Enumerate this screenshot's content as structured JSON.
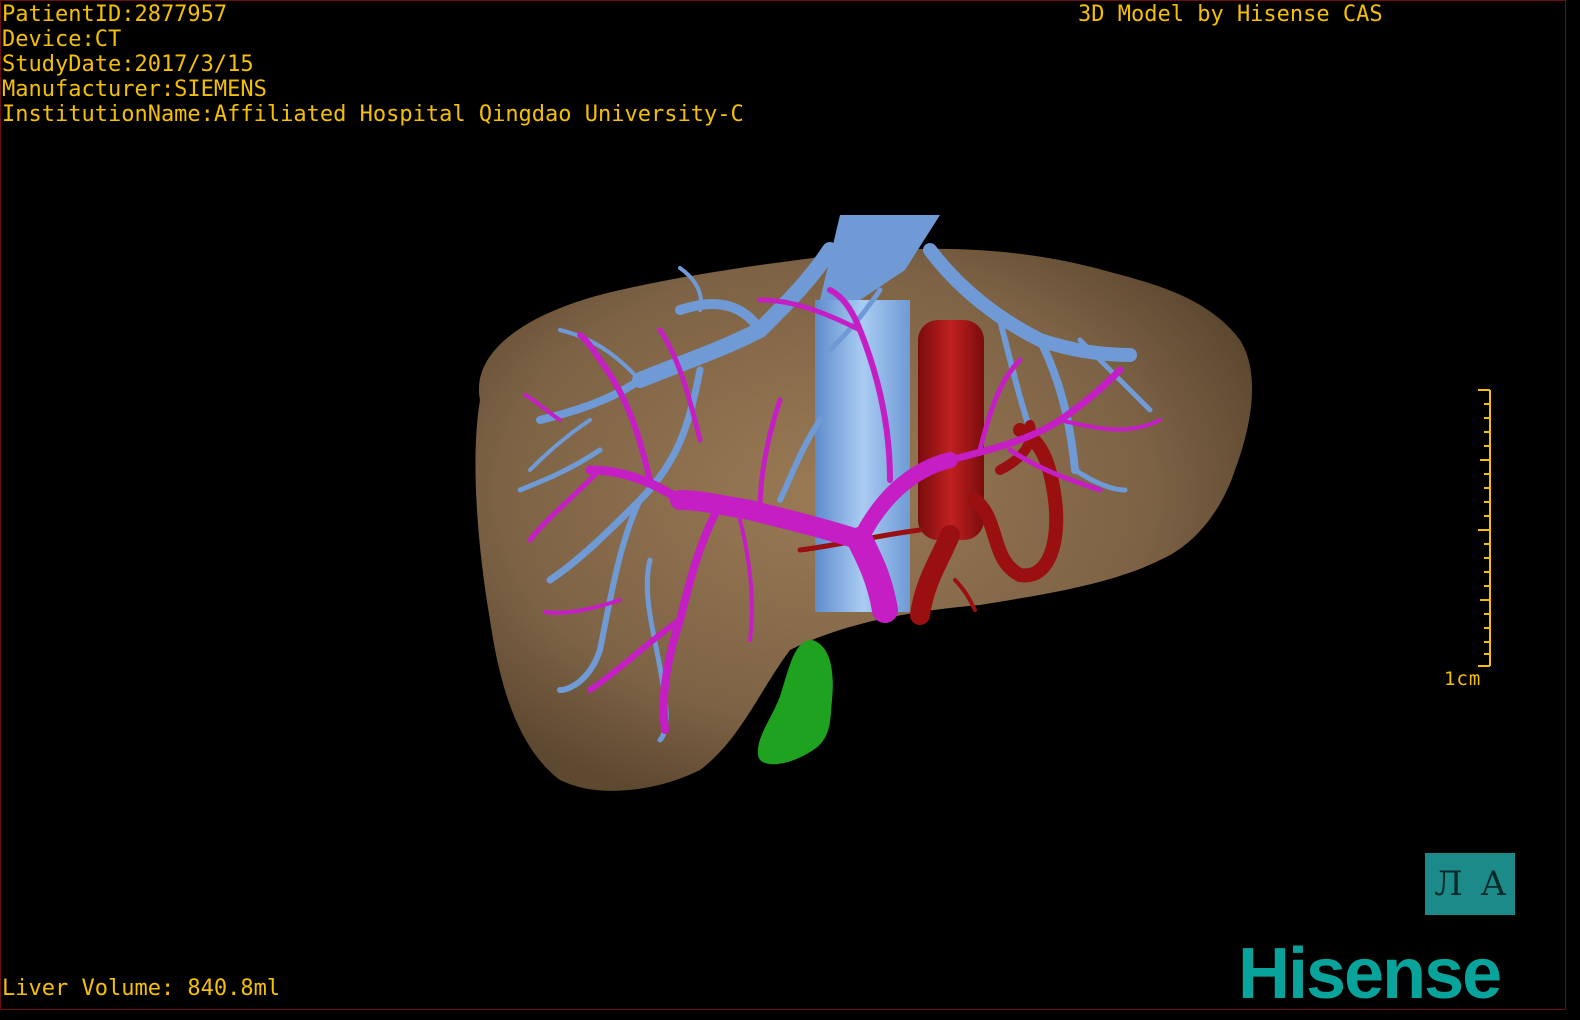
{
  "patient": {
    "id_line": "PatientID:2877957",
    "device_line": "Device:CT",
    "study_date_line": "StudyDate:2017/3/15",
    "manufacturer_line": "Manufacturer:SIEMENS",
    "institution_line": "InstitutionName:Affiliated Hospital Qingdao University-C"
  },
  "model_credit": "3D Model by Hisense CAS",
  "liver_volume": "Liver Volume: 840.8ml",
  "ruler": {
    "label": "1cm"
  },
  "toolbar": {
    "button_left": "Л",
    "button_right": "A"
  },
  "brand": "Hisense",
  "colors": {
    "overlay_text": "#f5c000",
    "liver": "#7d6245",
    "hepatic_vein": "#6f9ad6",
    "portal_vein": "#c41ec4",
    "artery": "#9a1010",
    "gallbladder": "#1fa21f",
    "brand": "#08a39a"
  }
}
